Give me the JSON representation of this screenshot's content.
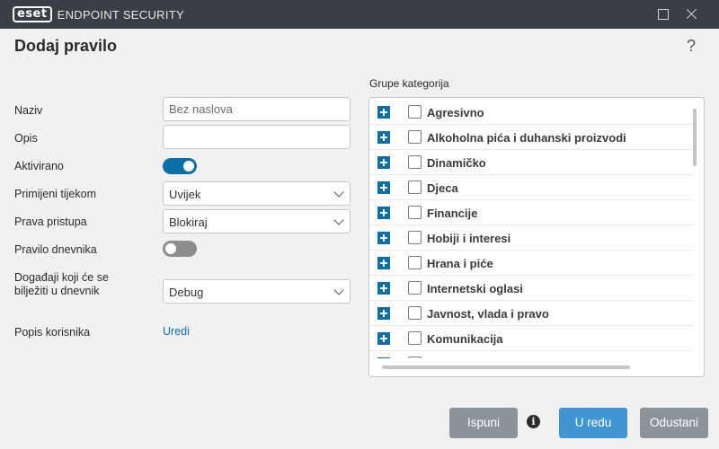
{
  "window": {
    "logo": "eset",
    "product": "ENDPOINT SECURITY",
    "icons": [
      "maximize-icon",
      "close-icon"
    ]
  },
  "page": {
    "title": "Dodaj pravilo",
    "help": "?"
  },
  "form": {
    "name_label": "Naziv",
    "name_placeholder": "Bez naslova",
    "desc_label": "Opis",
    "desc_value": "",
    "enabled_label": "Aktivirano",
    "enabled": true,
    "apply_label": "Primijeni tijekom",
    "apply_value": "Uvijek",
    "access_label": "Prava pristupa",
    "access_value": "Blokiraj",
    "log_label": "Pravilo dnevnika",
    "log_enabled": false,
    "events_label": "Događaji koji će se bilježiti u dnevnik",
    "events_value": "Debug",
    "users_label": "Popis korisnika",
    "users_link": "Uredi"
  },
  "categories": {
    "title": "Grupe kategorija",
    "items": [
      {
        "label": "Agresivno",
        "checked": false
      },
      {
        "label": "Alkoholna pića i duhanski proizvodi",
        "checked": false
      },
      {
        "label": "Dinamičko",
        "checked": false
      },
      {
        "label": "Djeca",
        "checked": false
      },
      {
        "label": "Financije",
        "checked": false
      },
      {
        "label": "Hobiji i interesi",
        "checked": false
      },
      {
        "label": "Hrana i piće",
        "checked": false
      },
      {
        "label": "Internetski oglasi",
        "checked": false
      },
      {
        "label": "Javnost, vlada i pravo",
        "checked": false
      },
      {
        "label": "Komunikacija",
        "checked": false
      }
    ]
  },
  "footer": {
    "fill_label": "Ispuni",
    "ok_label": "U redu",
    "cancel_label": "Odustani",
    "info_icon": "i"
  }
}
